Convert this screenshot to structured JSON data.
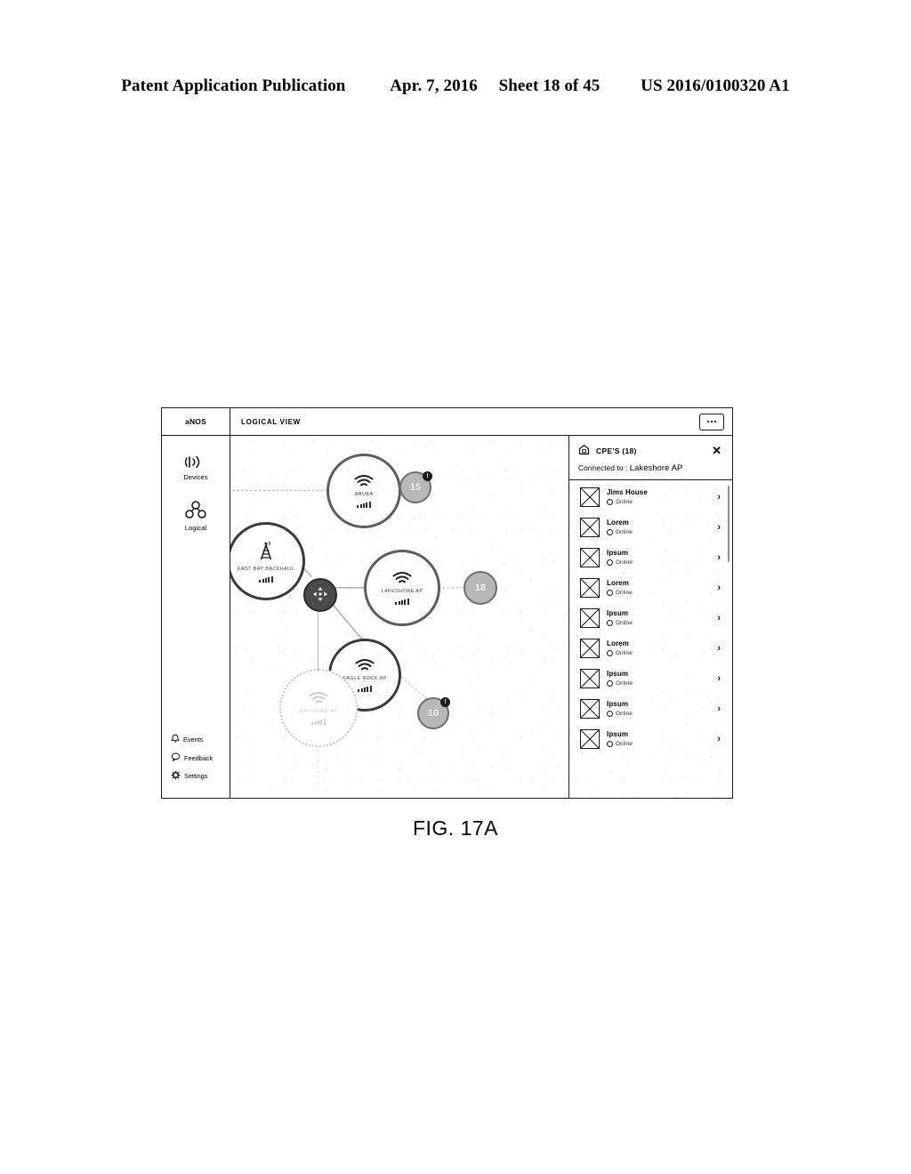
{
  "patent_header": {
    "publication": "Patent Application Publication",
    "date": "Apr. 7, 2016",
    "sheet": "Sheet 18 of 45",
    "number": "US 2016/0100320 A1"
  },
  "figure": {
    "caption": "FIG. 17A"
  },
  "app": {
    "brand": "aNOS",
    "view_title": "LOGICAL VIEW",
    "more_button": "…"
  },
  "sidebar": {
    "primary_items": [
      {
        "label": "Devices",
        "icon": "broadcast-icon"
      },
      {
        "label": "Logical",
        "icon": "topology-icon"
      }
    ],
    "bottom_items": [
      {
        "label": "Events",
        "icon": "bell-icon"
      },
      {
        "label": "Feedback",
        "icon": "speech-bubble-icon"
      },
      {
        "label": "Settings",
        "icon": "gear-icon"
      }
    ]
  },
  "canvas": {
    "nodes": [
      {
        "id": "aruba",
        "label": "ARUBA",
        "icon": "wifi-icon",
        "state": "active",
        "signal_bars": 5
      },
      {
        "id": "east-bay",
        "label": "EAST BAY BACKHAUL",
        "icon": "tower-icon",
        "state": "active",
        "signal_bars": 5
      },
      {
        "id": "lakeshore",
        "label": "LAKESHORE AP",
        "icon": "wifi-icon",
        "state": "active",
        "signal_bars": 5
      },
      {
        "id": "eagle-rock",
        "label": "EAGLE ROCK AP",
        "icon": "wifi-icon",
        "state": "active",
        "signal_bars": 5
      },
      {
        "id": "bayshore",
        "label": "BAYSHORE AP",
        "icon": "wifi-icon",
        "state": "faded",
        "signal_bars": 5
      }
    ],
    "hub": {
      "id": "hub",
      "icon": "move-arrows-icon"
    },
    "badges": [
      {
        "for": "aruba",
        "count": "15",
        "alert": "!"
      },
      {
        "for": "lakeshore",
        "count": "18",
        "alert": ""
      },
      {
        "for": "eagle-rock",
        "count": "10",
        "alert": "!"
      }
    ]
  },
  "cpe_panel": {
    "icon": "home-icon",
    "title": "CPE'S (18)",
    "close_label": "✕",
    "connected_label": "Connected to :",
    "connected_value": "Lakeshore AP",
    "chevron": "›",
    "items": [
      {
        "name": "Jims House",
        "status": "Online"
      },
      {
        "name": "Lorem",
        "status": "Online"
      },
      {
        "name": "Ipsum",
        "status": "Online"
      },
      {
        "name": "Lorem",
        "status": "Online"
      },
      {
        "name": "Ipsum",
        "status": "Online"
      },
      {
        "name": "Lorem",
        "status": "Online"
      },
      {
        "name": "Ipsum",
        "status": "Online"
      },
      {
        "name": "Ipsum",
        "status": "Online"
      },
      {
        "name": "Ipsum",
        "status": "Online"
      }
    ]
  }
}
